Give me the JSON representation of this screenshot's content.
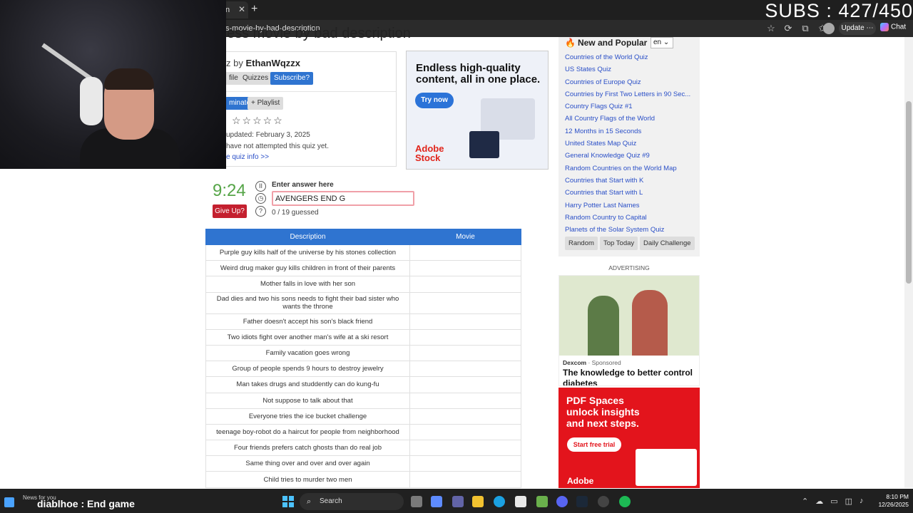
{
  "browser": {
    "tab_title": "n",
    "tab_close_glyph": "✕",
    "new_tab_glyph": "+",
    "url": "s-movie-by-bad-description",
    "update_label": "Update",
    "update_more": "⋯",
    "chat_label": "Chat",
    "icons": [
      "star-icon",
      "refresh-icon",
      "extensions-icon",
      "favorites-icon"
    ]
  },
  "overlay": {
    "subs_text": "SUBS : 427/450",
    "stream_title": "diablhoe : End game",
    "news_label": "News for you"
  },
  "page": {
    "title_fragment": "ess movie by bad description"
  },
  "quiz_info": {
    "by_prefix": "z by",
    "author": "EthanWqzzx",
    "profile_btn": "file",
    "quizzes_btn": "Quizzes",
    "subscribe_btn": "Subscribe?",
    "nominate_btn": "minate",
    "playlist_btn": "+ Playlist",
    "stars": "☆☆☆☆☆",
    "updated": "updated: February 3, 2025",
    "attempt": "have not attempted this quiz yet.",
    "more_info": "e quiz info >>"
  },
  "ad1": {
    "headline": "Endless high-quality content, all in one place.",
    "cta": "Try now",
    "brand_line1": "Adobe",
    "brand_line2": "Stock"
  },
  "game": {
    "timer": "9:24",
    "give_up": "Give Up?",
    "enter_label": "Enter answer here",
    "answer_value": "AVENGERS END G",
    "guessed": "0 / 19 guessed"
  },
  "table": {
    "headers": [
      "Description",
      "Movie"
    ],
    "rows": [
      "Purple guy kills half of the universe by his stones collection",
      "Weird drug maker guy kills children in front of their parents",
      "Mother falls in love with her son",
      "Dad dies and two his sons needs to fight their bad sister who wants the throne",
      "Father doesn't accept his son's black friend",
      "Two idiots fight over another man's wife at a ski resort",
      "Family vacation goes wrong",
      "Group of people spends 9 hours to destroy jewelry",
      "Man takes drugs and studdently can do kung-fu",
      "Not suppose to talk about that",
      "Everyone tries the ice bucket challenge",
      "teenage boy-robot do a haircut for people from neighborhood",
      "Four friends prefers catch ghosts than do real job",
      "Same thing over and over and over again",
      "Child tries to murder two men"
    ]
  },
  "sidebar": {
    "title": "New and Popular",
    "fire_glyph": "🔥",
    "lang": "en",
    "links": [
      "Countries of the World Quiz",
      "US States Quiz",
      "Countries of Europe Quiz",
      "Countries by First Two Letters in 90 Sec...",
      "Country Flags Quiz #1",
      "All Country Flags of the World",
      "12 Months in 15 Seconds",
      "United States Map Quiz",
      "General Knowledge Quiz #9",
      "Random Countries on the World Map",
      "Countries that Start with K",
      "Countries that Start with L",
      "Harry Potter Last Names",
      "Random Country to Capital",
      "Planets of the Solar System Quiz"
    ],
    "buttons": [
      "Random",
      "Top Today",
      "Daily Challenge"
    ]
  },
  "ad2": {
    "label": "ADVERTISING",
    "sponsor": "Dexcom",
    "sponsored": " · Sponsored",
    "headline": "The knowledge to better control",
    "headline2": "diabetes"
  },
  "ad3": {
    "headline": "PDF Spaces unlock insights and next steps.",
    "cta": "Start free trial",
    "brand": "Adobe"
  },
  "taskbar": {
    "search_placeholder": "Search",
    "time": "8:10 PM",
    "date": "12/26/2025"
  },
  "colors": {
    "accent_blue": "#2f74d0",
    "timer_green": "#56a548",
    "give_up_red": "#c4202f",
    "link_blue": "#2a4fc7",
    "adobe_red": "#e3141c"
  }
}
